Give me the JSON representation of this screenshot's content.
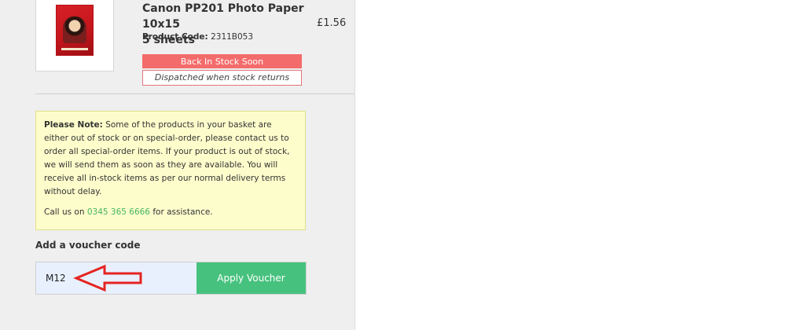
{
  "product": {
    "name_line1": "Canon PP201 Photo Paper 10x15",
    "name_line2": "5 sheets",
    "code_label": "Product Code:",
    "code_value": "2311B053",
    "price": "£1.56",
    "stock_status": "Back In Stock Soon",
    "dispatch_note": "Dispatched when stock returns"
  },
  "notice": {
    "lead": "Please Note:",
    "body": "Some of the products in your basket are either out of stock or on special-order, please contact us to order all special-order items. If your product is out of stock, we will send them as soon as they are available. You will receive all in-stock items as per our normal delivery terms without delay.",
    "call_prefix": "Call us on",
    "phone": "0345 365 6666",
    "call_suffix": "for assistance."
  },
  "voucher": {
    "heading": "Add a voucher code",
    "input_value": "M12",
    "apply_label": "Apply Voucher"
  },
  "colors": {
    "stock_status_bg": "#f46b6b",
    "apply_button_bg": "#47c27e",
    "notice_bg": "#fdfdcc",
    "annotation_arrow": "#e52421"
  }
}
